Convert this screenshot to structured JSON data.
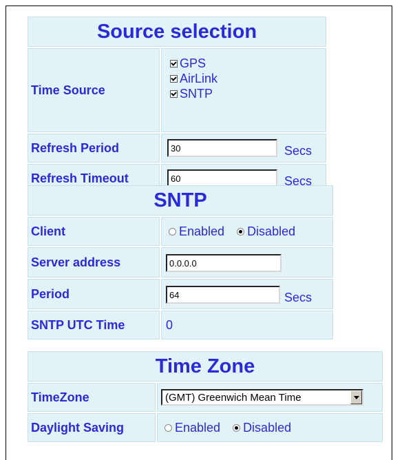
{
  "source_selection": {
    "heading": "Source selection",
    "time_source_label": "Time Source",
    "time_sources": [
      {
        "label": "GPS",
        "checked": true
      },
      {
        "label": "AirLink",
        "checked": true
      },
      {
        "label": "SNTP",
        "checked": true
      }
    ],
    "refresh_period_label": "Refresh Period",
    "refresh_period_value": "30",
    "refresh_period_unit": "Secs",
    "refresh_timeout_label": "Refresh Timeout",
    "refresh_timeout_value": "60",
    "refresh_timeout_unit": "Secs"
  },
  "sntp": {
    "heading": "SNTP",
    "client_label": "Client",
    "client_options": [
      "Enabled",
      "Disabled"
    ],
    "client_selected": "Disabled",
    "server_address_label": "Server address",
    "server_address_value": "0.0.0.0",
    "period_label": "Period",
    "period_value": "64",
    "period_unit": "Secs",
    "utc_time_label": "SNTP UTC Time",
    "utc_time_value": "0"
  },
  "time_zone": {
    "heading": "Time Zone",
    "timezone_label": "TimeZone",
    "timezone_selected": "(GMT) Greenwich Mean Time",
    "daylight_saving_label": "Daylight Saving",
    "daylight_options": [
      "Enabled",
      "Disabled"
    ],
    "daylight_selected": "Disabled"
  },
  "colors": {
    "label": "#2a2ad8",
    "cell_bg": "#e2f3f8"
  }
}
